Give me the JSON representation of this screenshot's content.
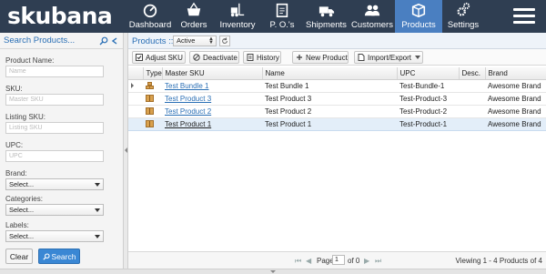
{
  "brand": {
    "logo": "skubana"
  },
  "nav": [
    {
      "label": "Dashboard",
      "icon": "dashboard-icon",
      "active": false
    },
    {
      "label": "Orders",
      "icon": "basket-icon",
      "active": false
    },
    {
      "label": "Inventory",
      "icon": "forklift-icon",
      "active": false
    },
    {
      "label": "P. O.'s",
      "icon": "clipboard-icon",
      "active": false
    },
    {
      "label": "Shipments",
      "icon": "truck-icon",
      "active": false
    },
    {
      "label": "Customers",
      "icon": "users-icon",
      "active": false
    },
    {
      "label": "Products",
      "icon": "box-icon",
      "active": true
    },
    {
      "label": "Settings",
      "icon": "gears-icon",
      "active": false
    }
  ],
  "sidebar": {
    "title": "Search Products...",
    "fields": {
      "product_name": {
        "label": "Product Name:",
        "placeholder": "Name"
      },
      "sku": {
        "label": "SKU:",
        "placeholder": "Master SKU"
      },
      "listing_sku": {
        "label": "Listing SKU:",
        "placeholder": "Listing SKU"
      },
      "upc": {
        "label": "UPC:",
        "placeholder": "UPC"
      },
      "brand": {
        "label": "Brand:",
        "value": "Select..."
      },
      "categories": {
        "label": "Categories:",
        "value": "Select..."
      },
      "labels": {
        "label": "Labels:",
        "value": "Select..."
      }
    },
    "clear_label": "Clear",
    "search_label": "Search"
  },
  "main": {
    "title": "Products ::",
    "status_value": "Active",
    "toolbar": {
      "adjust_sku": "Adjust SKU",
      "deactivate": "Deactivate",
      "history": "History",
      "new_product": "New Product",
      "import_export": "Import/Export"
    },
    "columns": [
      "Type",
      "Master SKU",
      "Name",
      "UPC",
      "Desc.",
      "Brand"
    ],
    "rows": [
      {
        "type": "bundle",
        "sku": "Test Bundle 1",
        "name": "Test Bundle 1",
        "upc": "Test-Bundle-1",
        "desc": "",
        "brand": "Awesome Brand",
        "selected": false
      },
      {
        "type": "product",
        "sku": "Test Product 3",
        "name": "Test Product 3",
        "upc": "Test-Product-3",
        "desc": "",
        "brand": "Awesome Brand",
        "selected": false
      },
      {
        "type": "product",
        "sku": "Test Product 2",
        "name": "Test Product 2",
        "upc": "Test-Product-2",
        "desc": "",
        "brand": "Awesome Brand",
        "selected": false
      },
      {
        "type": "product",
        "sku": "Test Product 1",
        "name": "Test Product 1",
        "upc": "Test-Product-1",
        "desc": "",
        "brand": "Awesome Brand",
        "selected": true
      }
    ],
    "pager": {
      "page_label": "Page",
      "page_value": "1",
      "of_label": "of 0",
      "viewing": "Viewing 1 - 4 Products of 4"
    }
  },
  "colors": {
    "nav_bg": "#2f3e52",
    "nav_active": "#4a7fc1",
    "link": "#2a6fb5",
    "search_btn": "#3a87d4"
  }
}
